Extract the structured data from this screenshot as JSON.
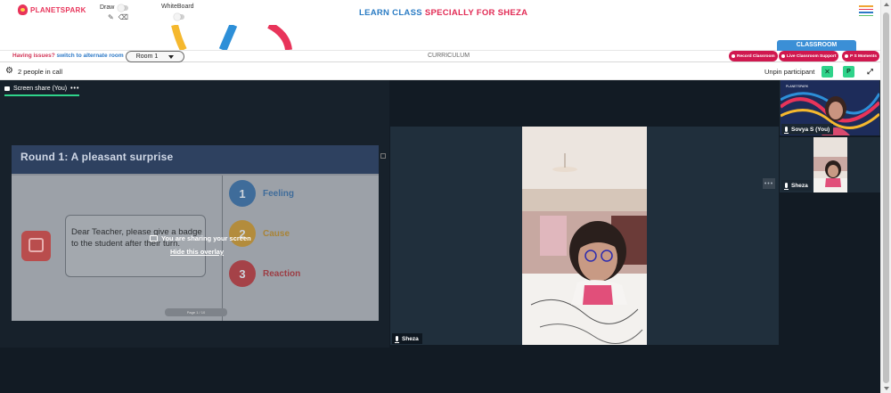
{
  "header": {
    "logo_text": "PLANETSPARK",
    "draw_label": "Draw",
    "whiteboard_label": "WhiteBoard",
    "title_part1": "LEARN CLASS",
    "title_part2": "SPECIALLY FOR SHEZA",
    "menu_colors": [
      "#f0a534",
      "#e8345a",
      "#2d79c7",
      "#5cc36b"
    ]
  },
  "infobar": {
    "issues_text": "Having issues?",
    "alternate_text": "switch to alternate room",
    "room_selected": "Room 1",
    "curriculum_label": "CURRICULUM",
    "classroom_tab": "CLASSROOM",
    "record_button": "Record Classroom",
    "support_button": "Live Classroom Support",
    "moments_button": "P S Moments"
  },
  "callbar": {
    "people_count": "2 people in call",
    "unpin_label": "Unpin participant",
    "p_label": "P"
  },
  "share": {
    "tab_label": "Screen share (You)",
    "more_dots": "•••",
    "overlay_message": "You are sharing your screen",
    "hide_overlay": "Hide this overlay",
    "slide": {
      "title": "Round 1:  A pleasant surprise",
      "speech": "Dear Teacher, please give a badge to the student after their turn.",
      "steps": [
        {
          "num": "1",
          "label": "Feeling",
          "color": "#3f6c9a",
          "text_color": "#3f6c9a"
        },
        {
          "num": "2",
          "label": "Cause",
          "color": "#b38c3c",
          "text_color": "#a88438"
        },
        {
          "num": "3",
          "label": "Reaction",
          "color": "#a54248",
          "text_color": "#9c3d44"
        }
      ],
      "pager_text": "Page 1 / 10"
    }
  },
  "participants": {
    "main_name": "Sheza",
    "tile1_name": "Sovya S (You)",
    "tile2_name": "Sheza",
    "tile1_logo": "PLANETSPARK"
  },
  "colors": {
    "accent_green": "#2fd38a",
    "brand_red": "#d0184f",
    "brand_blue": "#3b8fd6"
  }
}
